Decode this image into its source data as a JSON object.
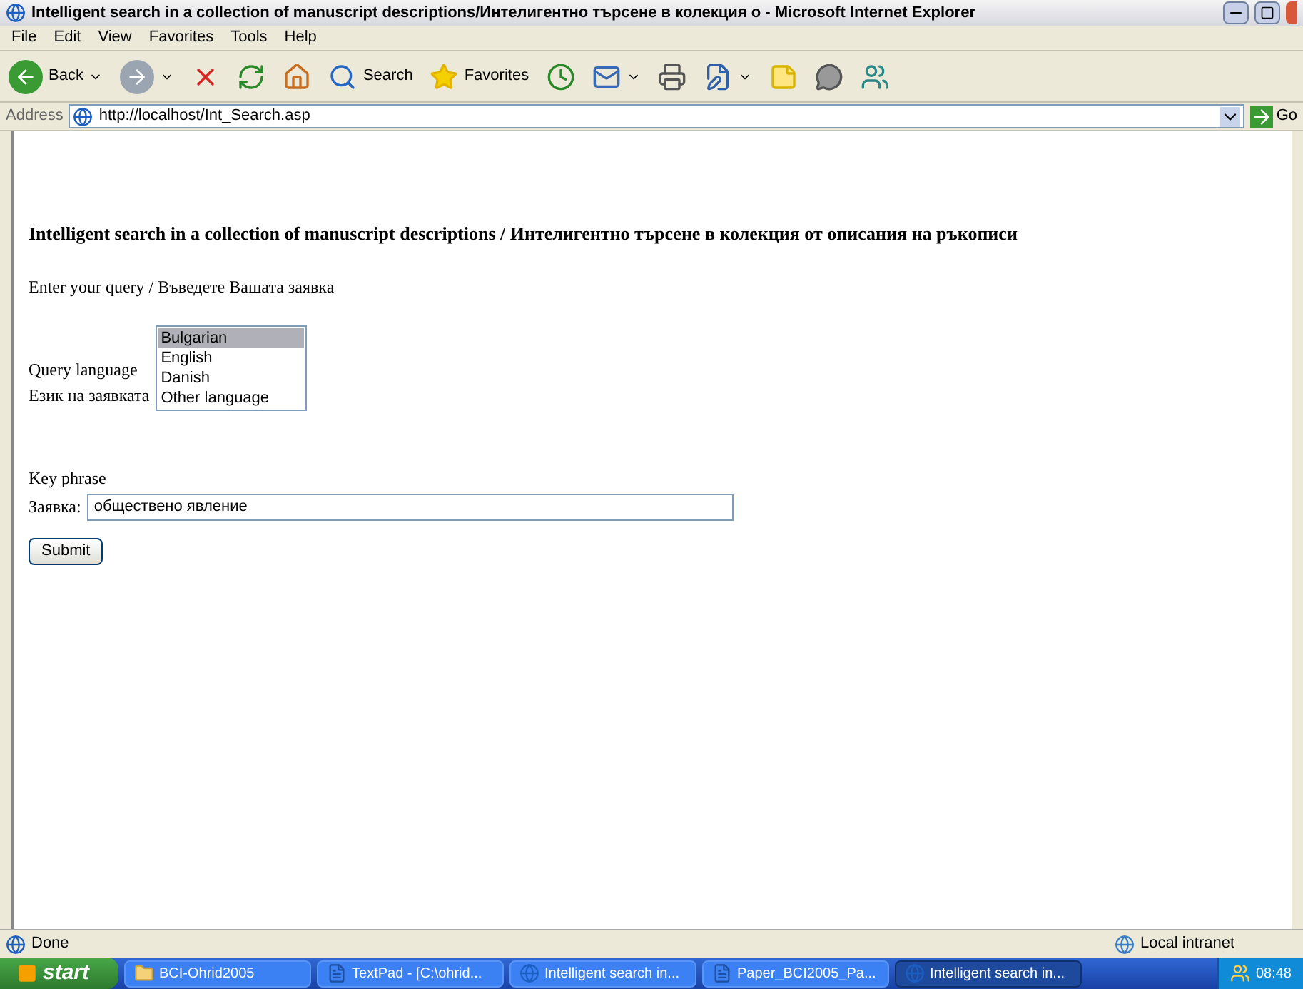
{
  "window": {
    "title": "Intelligent search in a collection of manuscript descriptions/Интелигентно търсене в колекция о - Microsoft Internet Explorer"
  },
  "menu": [
    "File",
    "Edit",
    "View",
    "Favorites",
    "Tools",
    "Help"
  ],
  "toolbar": [
    {
      "kind": "back",
      "label": "Back"
    },
    {
      "kind": "forward"
    },
    {
      "kind": "stop"
    },
    {
      "kind": "refresh"
    },
    {
      "kind": "home"
    },
    {
      "kind": "search",
      "label": "Search"
    },
    {
      "kind": "favorites",
      "label": "Favorites"
    },
    {
      "kind": "history"
    },
    {
      "kind": "mail"
    },
    {
      "kind": "print"
    },
    {
      "kind": "edit"
    },
    {
      "kind": "note"
    },
    {
      "kind": "discuss"
    },
    {
      "kind": "messenger"
    }
  ],
  "address": {
    "label": "Address",
    "value": "http://localhost/Int_Search.asp",
    "go": "Go"
  },
  "page": {
    "heading": "Intelligent search in a collection of manuscript descriptions / Интелигентно търсене в колекция от описания на ръкописи",
    "intro": "Enter your query / Въведете Вашата заявка",
    "language_label": [
      "Query language",
      "Език на заявката"
    ],
    "languages": [
      {
        "label": "Bulgarian",
        "selected": true
      },
      {
        "label": "English",
        "selected": false
      },
      {
        "label": "Danish",
        "selected": false
      },
      {
        "label": "Other language",
        "selected": false
      }
    ],
    "key_phrase_label": "Key phrase",
    "query_label": "Заявка:",
    "query_value": "обществено явление",
    "submit": "Submit"
  },
  "status_bar": {
    "status": "Done",
    "zone": "Local intranet"
  },
  "taskbar": {
    "start": "start",
    "tasks": [
      {
        "label": "BCI-Ohrid2005",
        "kind": "folder",
        "selected": false
      },
      {
        "label": "TextPad - [C:\\ohrid...",
        "kind": "textpad",
        "selected": false
      },
      {
        "label": "Intelligent search in...",
        "kind": "ie",
        "selected": false
      },
      {
        "label": "Paper_BCI2005_Pa...",
        "kind": "word",
        "selected": false
      },
      {
        "label": "Intelligent search in...",
        "kind": "ie",
        "selected": true
      }
    ],
    "clock": "08:48"
  }
}
